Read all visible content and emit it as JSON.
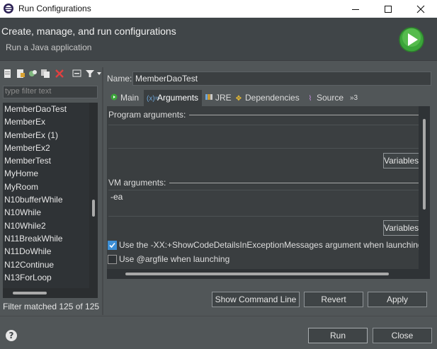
{
  "window": {
    "title": "Run Configurations",
    "minimize_icon": "minimize-icon",
    "maximize_icon": "maximize-icon",
    "close_icon": "close-icon"
  },
  "header": {
    "title": "Create, manage, and run configurations",
    "subtitle": "Run a Java application",
    "badge_icon": "run-icon"
  },
  "left": {
    "toolbar_icons": [
      "new-configuration-icon",
      "new-prototype-icon",
      "export-icon",
      "duplicate-icon",
      "delete-icon",
      "collapse-all-icon",
      "filter-icon",
      "view-menu-icon"
    ],
    "filter_placeholder": "type filter text",
    "items": [
      "MemberDaoTest",
      "MemberEx",
      "MemberEx (1)",
      "MemberEx2",
      "MemberTest",
      "MyHome",
      "MyRoom",
      "N10bufferWhile",
      "N10While",
      "N10While2",
      "N11BreakWhile",
      "N11DoWhile",
      "N12Continue",
      "N13ForLoop"
    ],
    "filter_status": "Filter matched 125 of 125"
  },
  "right": {
    "name_label": "Name:",
    "name_value": "MemberDaoTest",
    "tabs": [
      {
        "label": "Main",
        "icon": "main-tab-icon"
      },
      {
        "label": "Arguments",
        "icon": "arguments-tab-icon"
      },
      {
        "label": "JRE",
        "icon": "jre-tab-icon"
      },
      {
        "label": "Dependencies",
        "icon": "dependencies-tab-icon"
      },
      {
        "label": "Source",
        "icon": "source-tab-icon"
      },
      {
        "label": "»3",
        "icon": ""
      }
    ],
    "active_tab": "Arguments",
    "program_args_label": "Program arguments:",
    "program_args_value": "",
    "variables_label": "Variables...",
    "vm_args_label": "VM arguments:",
    "vm_args_value": "-ea",
    "checkbox1_label": "Use the -XX:+ShowCodeDetailsInExceptionMessages argument when launching",
    "checkbox1_checked": true,
    "checkbox2_label": "Use @argfile when launching",
    "checkbox2_checked": false,
    "show_command_line": "Show Command Line",
    "revert": "Revert",
    "apply": "Apply"
  },
  "footer": {
    "help_icon": "help-icon",
    "run": "Run",
    "close": "Close"
  }
}
